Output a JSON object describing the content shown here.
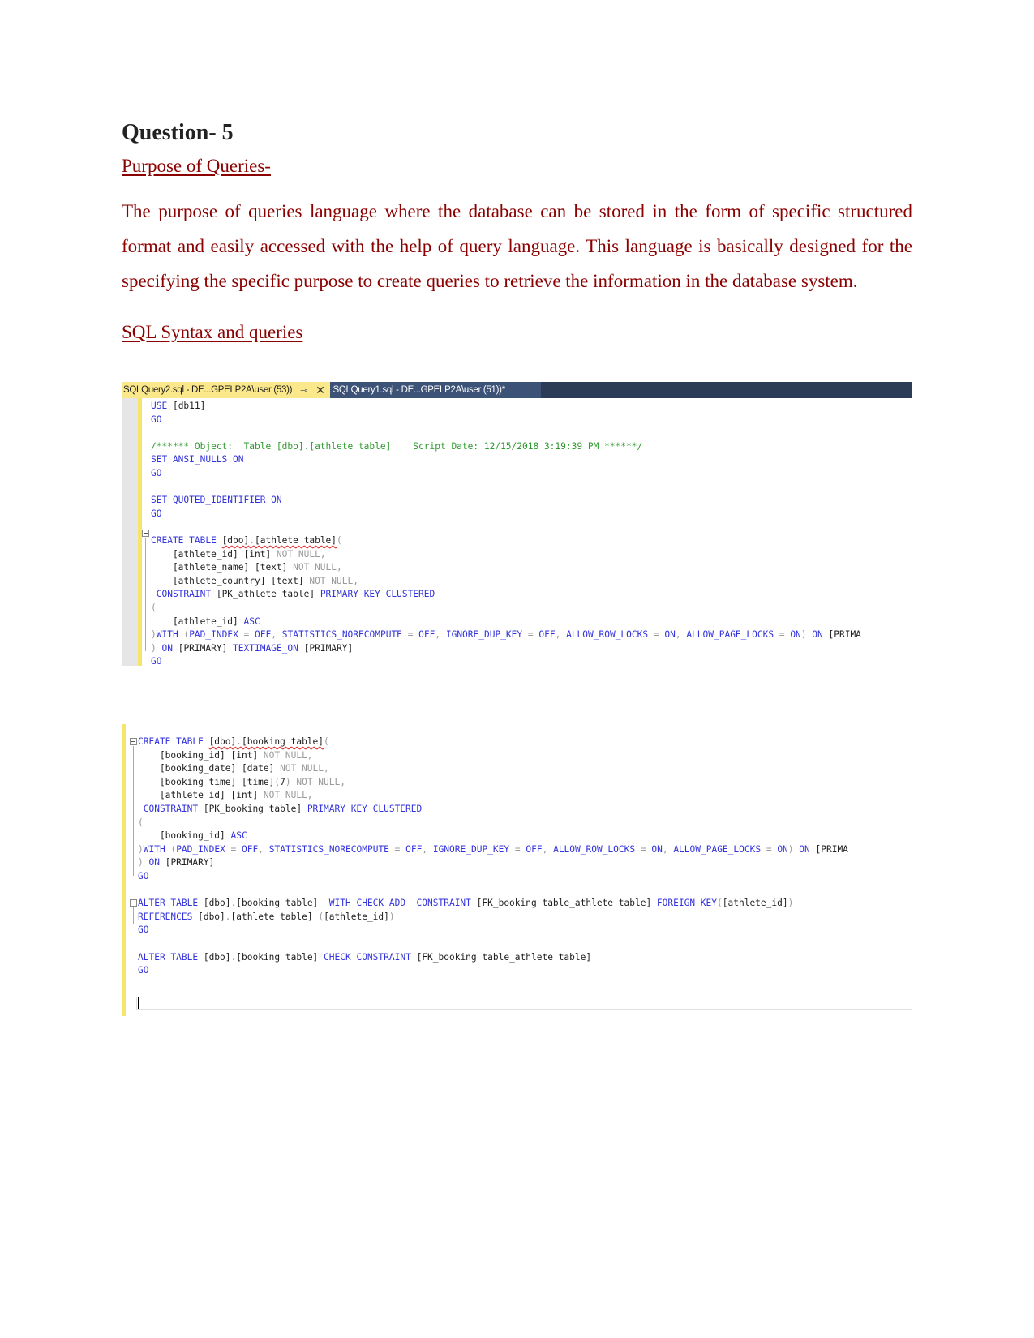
{
  "document": {
    "heading": "Question- 5",
    "section1_title": "Purpose of Queries- ",
    "section1_body": "The purpose of queries language where the database can be stored in the form of specific structured format and easily accessed with the help of query language. This language is basically designed for the specifying the specific purpose to create queries to retrieve the information in the database system.",
    "section2_title": "SQL Syntax and queries"
  },
  "ssms": {
    "tabs": [
      {
        "label": "SQLQuery2.sql - DE...GPELP2A\\user (53))",
        "active": true,
        "pin_icon": "pin-icon",
        "close_icon": "close-icon"
      },
      {
        "label": "SQLQuery1.sql - DE...GPELP2A\\user (51))*",
        "active": false
      }
    ],
    "colors": {
      "tab_active": "#fbe88a",
      "tab_bar": "#2c3c56",
      "keyword": "#3333dd",
      "comment": "#2e9a2e",
      "null": "#9a9a9a"
    }
  },
  "screenshot1": {
    "lines": [
      [
        {
          "t": "USE ",
          "c": "kw"
        },
        {
          "t": "[db11]"
        }
      ],
      [
        {
          "t": "GO",
          "c": "kw"
        }
      ],
      [],
      [
        {
          "t": "/****** Object:  Table [dbo].[athlete table]    Script Date: 12/15/2018 3:19:39 PM ******/",
          "c": "cm"
        }
      ],
      [
        {
          "t": "SET ANSI_NULLS ON",
          "c": "kw"
        }
      ],
      [
        {
          "t": "GO",
          "c": "kw"
        }
      ],
      [],
      [
        {
          "t": "SET QUOTED_IDENTIFIER ON",
          "c": "kw"
        }
      ],
      [
        {
          "t": "GO",
          "c": "kw"
        }
      ],
      [],
      [
        {
          "t": "CREATE TABLE ",
          "c": "kw"
        },
        {
          "t": "[dbo]",
          "c": "sq"
        },
        {
          "t": ".",
          "c": "gr sq"
        },
        {
          "t": "[athlete table]",
          "c": "sq"
        },
        {
          "t": "(",
          "c": "gr"
        }
      ],
      [
        {
          "t": "    [athlete_id] [int] "
        },
        {
          "t": "NOT NULL,",
          "c": "gr"
        }
      ],
      [
        {
          "t": "    [athlete_name] [text] "
        },
        {
          "t": "NOT NULL,",
          "c": "gr"
        }
      ],
      [
        {
          "t": "    [athlete_country] [text] "
        },
        {
          "t": "NOT NULL,",
          "c": "gr"
        }
      ],
      [
        {
          "t": " CONSTRAINT ",
          "c": "kw"
        },
        {
          "t": "[PK_athlete table] "
        },
        {
          "t": "PRIMARY KEY CLUSTERED",
          "c": "kw"
        }
      ],
      [
        {
          "t": "(",
          "c": "gr"
        }
      ],
      [
        {
          "t": "    [athlete_id] "
        },
        {
          "t": "ASC",
          "c": "kw"
        }
      ],
      [
        {
          "t": ")",
          "c": "gr"
        },
        {
          "t": "WITH ",
          "c": "kw"
        },
        {
          "t": "(",
          "c": "gr"
        },
        {
          "t": "PAD_INDEX ",
          "c": "kw"
        },
        {
          "t": "= ",
          "c": "gr"
        },
        {
          "t": "OFF",
          "c": "kw"
        },
        {
          "t": ", ",
          "c": "gr"
        },
        {
          "t": "STATISTICS_NORECOMPUTE ",
          "c": "kw"
        },
        {
          "t": "= ",
          "c": "gr"
        },
        {
          "t": "OFF",
          "c": "kw"
        },
        {
          "t": ", ",
          "c": "gr"
        },
        {
          "t": "IGNORE_DUP_KEY ",
          "c": "kw"
        },
        {
          "t": "= ",
          "c": "gr"
        },
        {
          "t": "OFF",
          "c": "kw"
        },
        {
          "t": ", ",
          "c": "gr"
        },
        {
          "t": "ALLOW_ROW_LOCKS ",
          "c": "kw"
        },
        {
          "t": "= ",
          "c": "gr"
        },
        {
          "t": "ON",
          "c": "kw"
        },
        {
          "t": ", ",
          "c": "gr"
        },
        {
          "t": "ALLOW_PAGE_LOCKS ",
          "c": "kw"
        },
        {
          "t": "= ",
          "c": "gr"
        },
        {
          "t": "ON",
          "c": "kw"
        },
        {
          "t": ") ",
          "c": "gr"
        },
        {
          "t": "ON ",
          "c": "kw"
        },
        {
          "t": "[PRIMA"
        }
      ],
      [
        {
          "t": ") ",
          "c": "gr"
        },
        {
          "t": "ON ",
          "c": "kw"
        },
        {
          "t": "[PRIMARY] "
        },
        {
          "t": "TEXTIMAGE_ON ",
          "c": "kw"
        },
        {
          "t": "[PRIMARY]"
        }
      ],
      [
        {
          "t": "GO",
          "c": "kw"
        }
      ]
    ]
  },
  "screenshot2": {
    "lines": [
      [
        {
          "t": "CREATE TABLE ",
          "c": "kw"
        },
        {
          "t": "[dbo]",
          "c": "sq"
        },
        {
          "t": ".",
          "c": "gr sq"
        },
        {
          "t": "[booking table]",
          "c": "sq"
        },
        {
          "t": "(",
          "c": "gr"
        }
      ],
      [
        {
          "t": "    [booking_id] [int] "
        },
        {
          "t": "NOT NULL,",
          "c": "gr"
        }
      ],
      [
        {
          "t": "    [booking_date] [date] "
        },
        {
          "t": "NOT NULL,",
          "c": "gr"
        }
      ],
      [
        {
          "t": "    [booking_time] [time]"
        },
        {
          "t": "(",
          "c": "gr"
        },
        {
          "t": "7"
        },
        {
          "t": ") NOT NULL,",
          "c": "gr"
        }
      ],
      [
        {
          "t": "    [athlete_id] [int] "
        },
        {
          "t": "NOT NULL,",
          "c": "gr"
        }
      ],
      [
        {
          "t": " CONSTRAINT ",
          "c": "kw"
        },
        {
          "t": "[PK_booking table] "
        },
        {
          "t": "PRIMARY KEY CLUSTERED",
          "c": "kw"
        }
      ],
      [
        {
          "t": "(",
          "c": "gr"
        }
      ],
      [
        {
          "t": "    [booking_id] "
        },
        {
          "t": "ASC",
          "c": "kw"
        }
      ],
      [
        {
          "t": ")",
          "c": "gr"
        },
        {
          "t": "WITH ",
          "c": "kw"
        },
        {
          "t": "(",
          "c": "gr"
        },
        {
          "t": "PAD_INDEX ",
          "c": "kw"
        },
        {
          "t": "= ",
          "c": "gr"
        },
        {
          "t": "OFF",
          "c": "kw"
        },
        {
          "t": ", ",
          "c": "gr"
        },
        {
          "t": "STATISTICS_NORECOMPUTE ",
          "c": "kw"
        },
        {
          "t": "= ",
          "c": "gr"
        },
        {
          "t": "OFF",
          "c": "kw"
        },
        {
          "t": ", ",
          "c": "gr"
        },
        {
          "t": "IGNORE_DUP_KEY ",
          "c": "kw"
        },
        {
          "t": "= ",
          "c": "gr"
        },
        {
          "t": "OFF",
          "c": "kw"
        },
        {
          "t": ", ",
          "c": "gr"
        },
        {
          "t": "ALLOW_ROW_LOCKS ",
          "c": "kw"
        },
        {
          "t": "= ",
          "c": "gr"
        },
        {
          "t": "ON",
          "c": "kw"
        },
        {
          "t": ", ",
          "c": "gr"
        },
        {
          "t": "ALLOW_PAGE_LOCKS ",
          "c": "kw"
        },
        {
          "t": "= ",
          "c": "gr"
        },
        {
          "t": "ON",
          "c": "kw"
        },
        {
          "t": ") ",
          "c": "gr"
        },
        {
          "t": "ON ",
          "c": "kw"
        },
        {
          "t": "[PRIMA"
        }
      ],
      [
        {
          "t": ") ",
          "c": "gr"
        },
        {
          "t": "ON ",
          "c": "kw"
        },
        {
          "t": "[PRIMARY]"
        }
      ],
      [
        {
          "t": "GO",
          "c": "kw"
        }
      ],
      [],
      [
        {
          "t": "ALTER TABLE ",
          "c": "kw"
        },
        {
          "t": "[dbo]"
        },
        {
          "t": ".",
          "c": "gr"
        },
        {
          "t": "[booking table]  "
        },
        {
          "t": "WITH CHECK ADD  CONSTRAINT ",
          "c": "kw"
        },
        {
          "t": "[FK_booking table_athlete table] "
        },
        {
          "t": "FOREIGN KEY",
          "c": "kw"
        },
        {
          "t": "(",
          "c": "gr"
        },
        {
          "t": "[athlete_id]"
        },
        {
          "t": ")",
          "c": "gr"
        }
      ],
      [
        {
          "t": "REFERENCES ",
          "c": "kw"
        },
        {
          "t": "[dbo]"
        },
        {
          "t": ".",
          "c": "gr"
        },
        {
          "t": "[athlete table] "
        },
        {
          "t": "(",
          "c": "gr"
        },
        {
          "t": "[athlete_id]"
        },
        {
          "t": ")",
          "c": "gr"
        }
      ],
      [
        {
          "t": "GO",
          "c": "kw"
        }
      ],
      [],
      [
        {
          "t": "ALTER TABLE ",
          "c": "kw"
        },
        {
          "t": "[dbo]"
        },
        {
          "t": ".",
          "c": "gr"
        },
        {
          "t": "[booking table] "
        },
        {
          "t": "CHECK CONSTRAINT ",
          "c": "kw"
        },
        {
          "t": "[FK_booking table_athlete table]"
        }
      ],
      [
        {
          "t": "GO",
          "c": "kw"
        }
      ]
    ]
  }
}
